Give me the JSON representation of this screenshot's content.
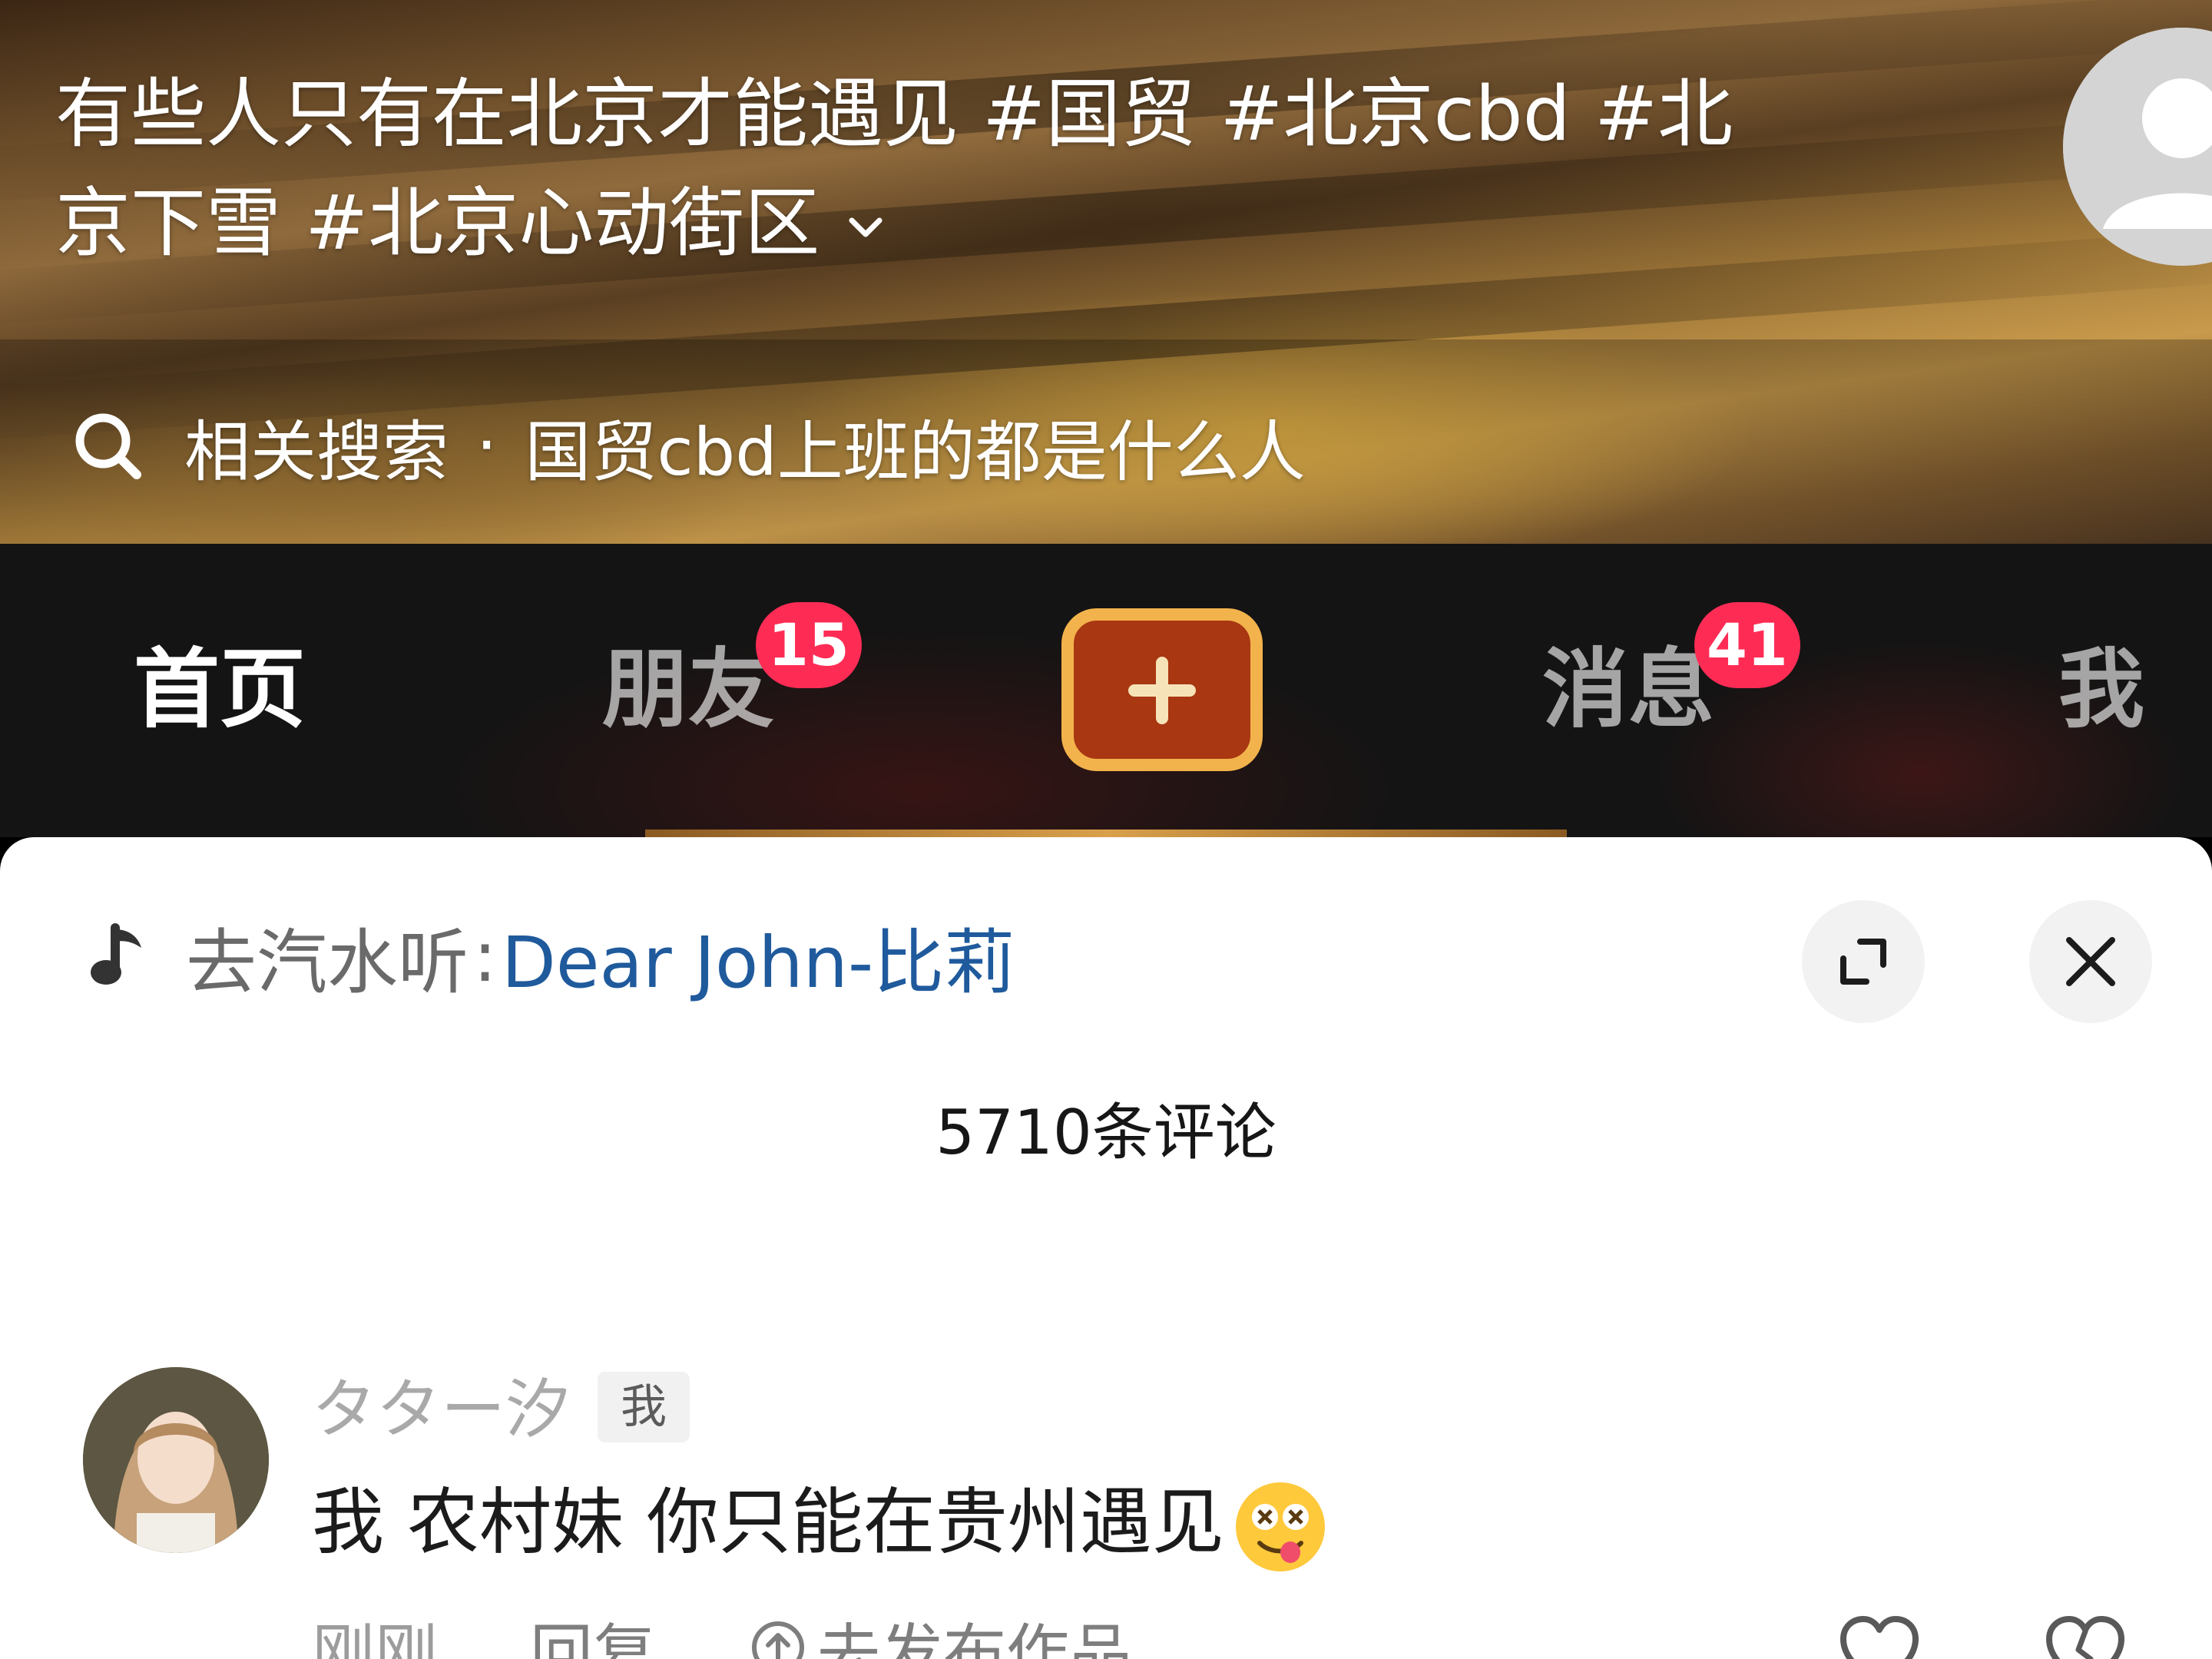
{
  "video": {
    "caption": "有些人只有在北京才能遇见 #国贸 #北京cbd #北京下雪 #北京心动街区",
    "caption_expand_icon": "chevron-down-icon",
    "related_search_label": "相关搜索",
    "related_search_separator": "·",
    "related_search_query": "国贸cbd上班的都是什么人"
  },
  "tabbar": {
    "home": "首页",
    "friends": "朋友",
    "friends_badge": "15",
    "create_icon": "plus-icon",
    "messages": "消息",
    "messages_badge": "41",
    "me": "我",
    "accent_color": "#fe2c55",
    "create_button_fill": "#a83712",
    "create_button_border": "#f3b34c"
  },
  "comments_sheet": {
    "music_prefix": "去汽水听",
    "music_colon": ":",
    "music_title": "Dear John-比莉",
    "expand_icon": "expand-icon",
    "close_icon": "close-icon",
    "count_label": "5710条评论",
    "comments": [
      {
        "username": "タター汐",
        "tag": "我",
        "text": "我 农村妹 你只能在贵州遇见",
        "emoji": "dizzy-tongue-emoji",
        "time": "刚刚",
        "reply_label": "回复",
        "publish_label": "去发布作品",
        "like_icon": "heart-icon",
        "dislike_icon": "broken-heart-icon"
      }
    ],
    "link_color": "#1f5a9c"
  }
}
